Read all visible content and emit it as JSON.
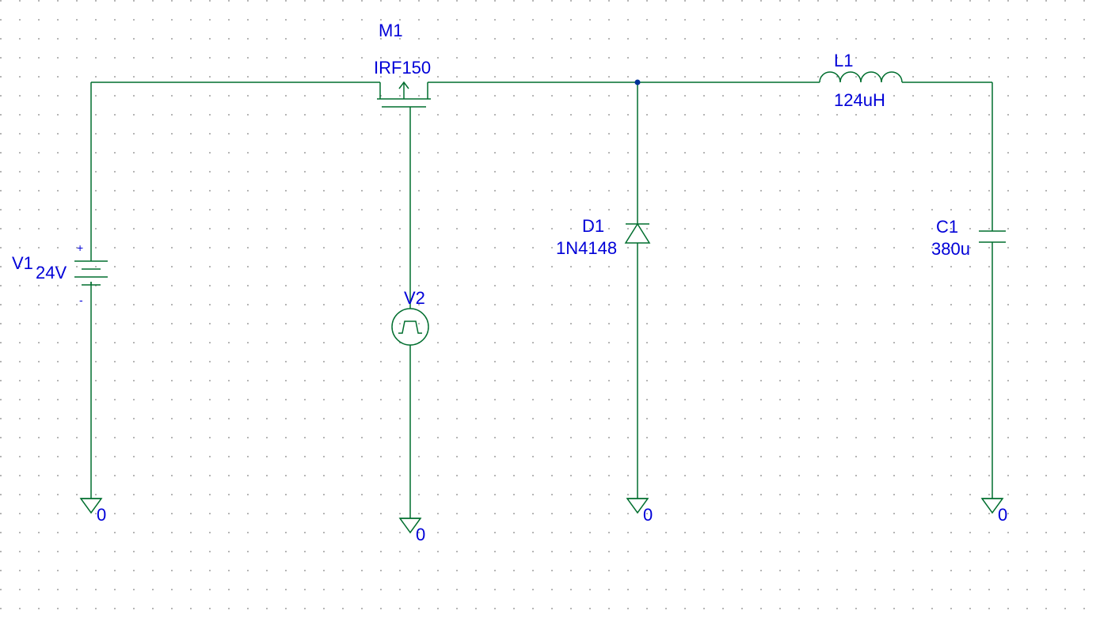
{
  "components": {
    "V1": {
      "ref": "V1",
      "value": "24V",
      "polarity_plus": "+",
      "polarity_minus": "-"
    },
    "M1": {
      "ref": "M1",
      "model": "IRF150"
    },
    "V2": {
      "ref": "V2"
    },
    "D1": {
      "ref": "D1",
      "model": "1N4148"
    },
    "L1": {
      "ref": "L1",
      "value": "124uH"
    },
    "C1": {
      "ref": "C1",
      "value": "380u"
    }
  },
  "grounds": {
    "g1": "0",
    "g2": "0",
    "g3": "0",
    "g4": "0"
  },
  "colors": {
    "wire": "#006e2e",
    "text": "#0000d8",
    "dotgrid": "#808080"
  }
}
